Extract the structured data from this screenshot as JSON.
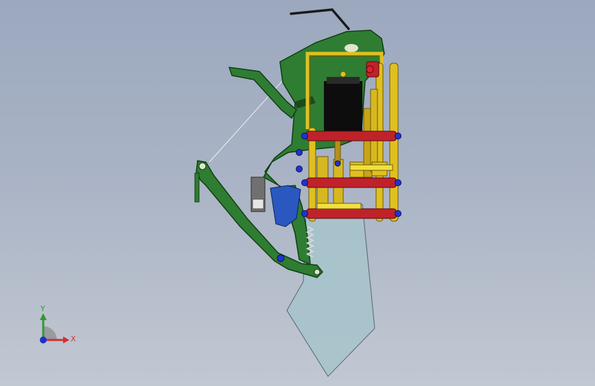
{
  "viewport": {
    "background_top": "#9ba8be",
    "background_bottom": "#c2c8d2"
  },
  "model": {
    "colors": {
      "frame": "#2e7d32",
      "frame_edge": "#0f3d12",
      "gold": "#e0c020",
      "gold_edge": "#6b5a00",
      "shaft": "#c0222a",
      "shaft_edge": "#5a0a0e",
      "motor": "#0d0d0d",
      "blade": "#a8c4cc",
      "bolt": "#2233cc",
      "blue_part": "#2a58c0",
      "spring": "#d0d0d0"
    }
  },
  "triad": {
    "y_label": "Y",
    "x_label": "X",
    "y_color": "#2f9a2f",
    "x_color": "#d03030",
    "z_color": "#1a2fd0"
  }
}
